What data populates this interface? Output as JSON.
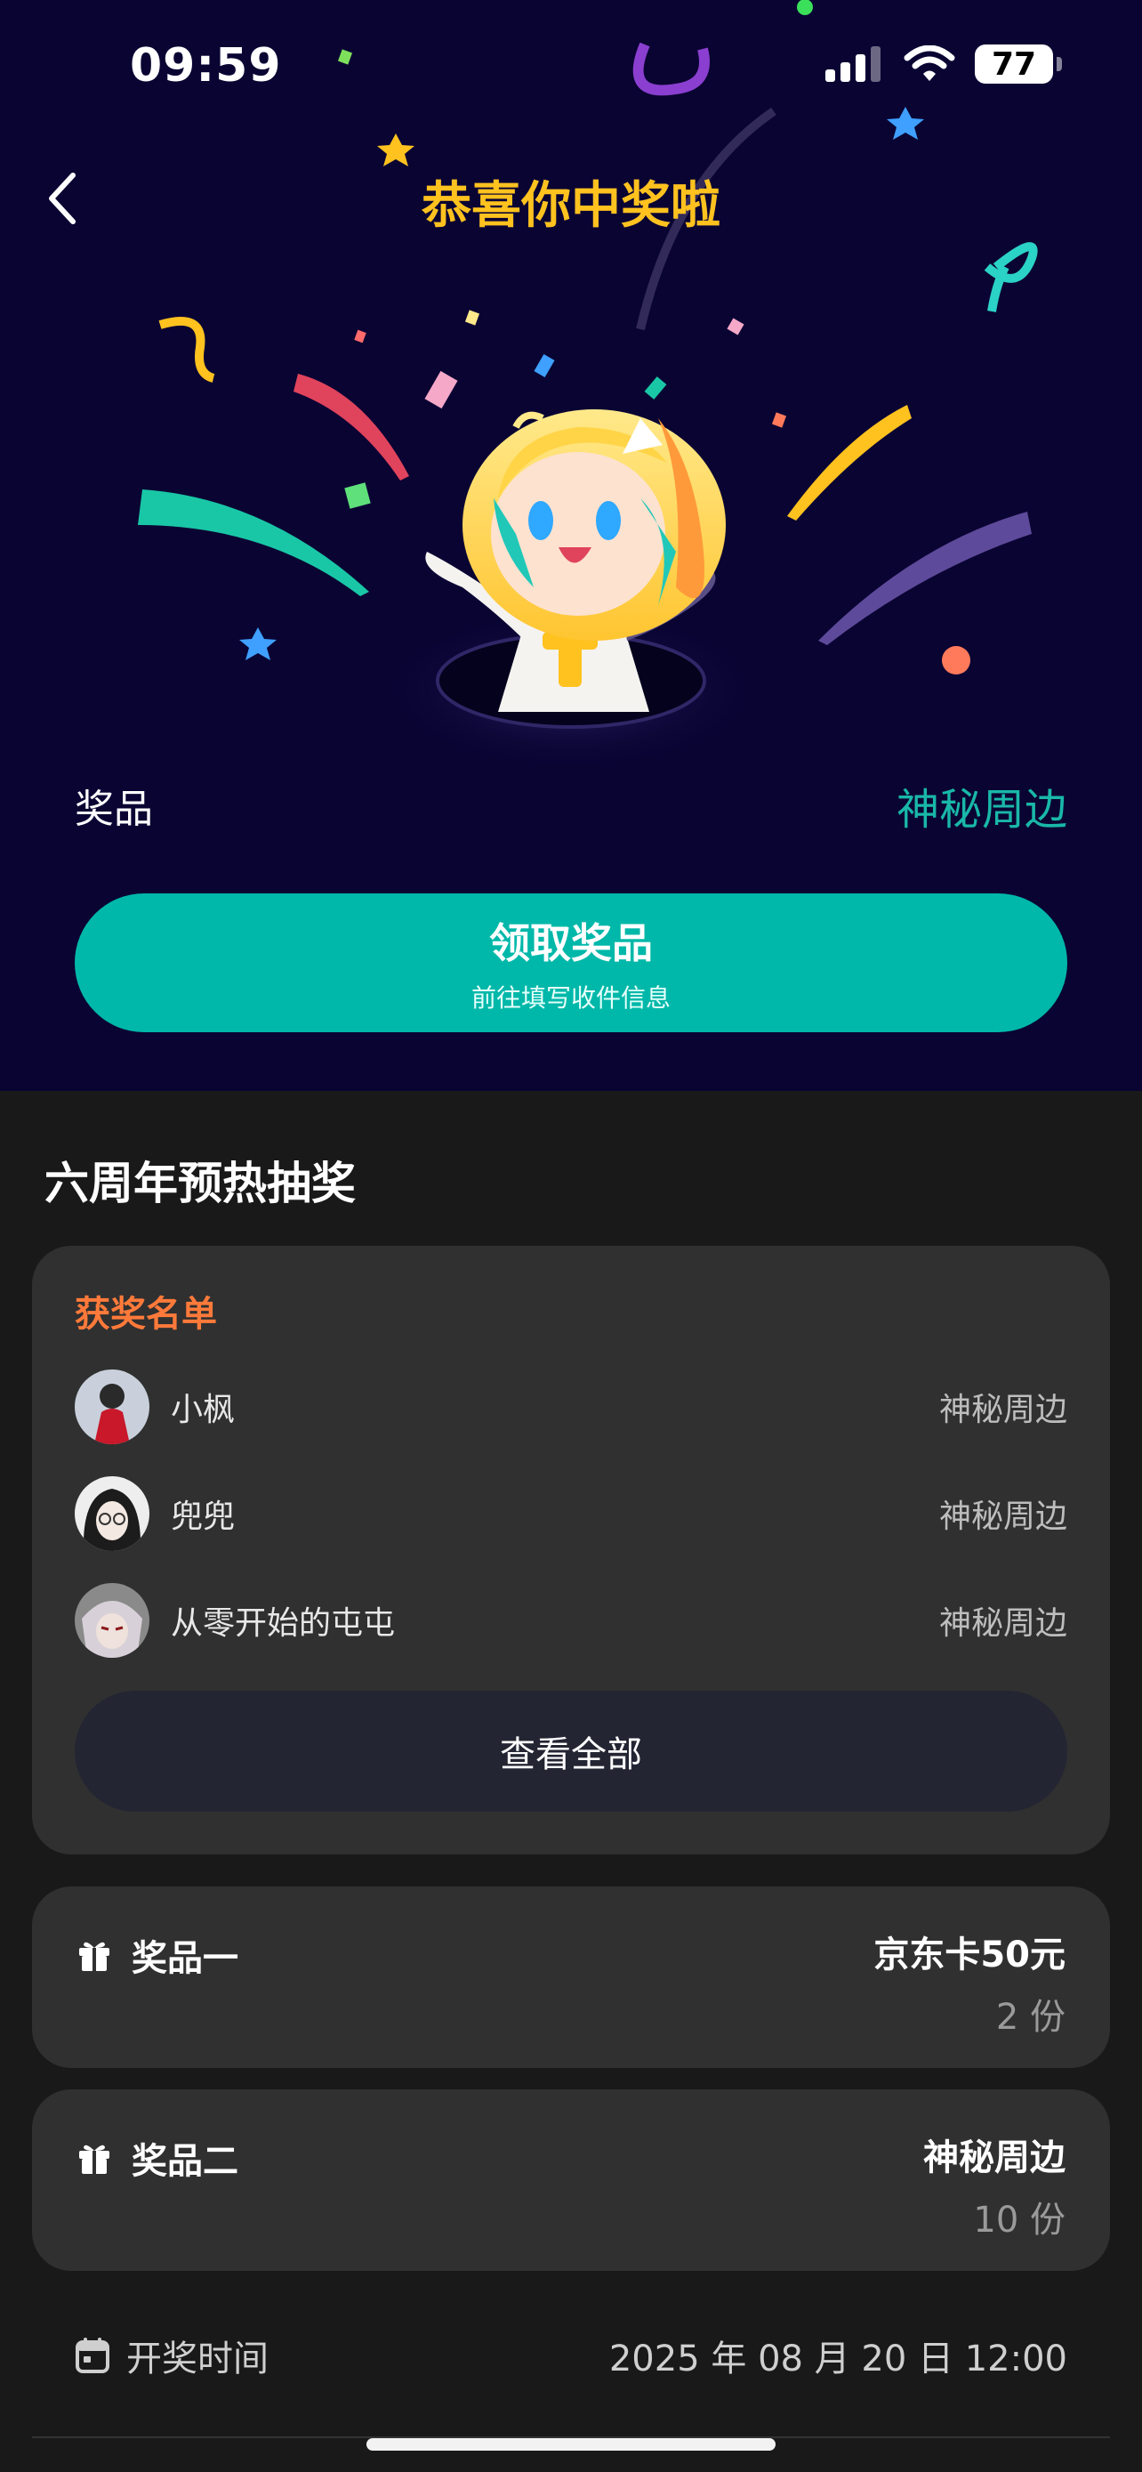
{
  "status_bar": {
    "time": "09:59",
    "battery": "77"
  },
  "header": {
    "title": "恭喜你中奖啦"
  },
  "prize": {
    "label": "奖品",
    "value": "神秘周边"
  },
  "claim_button": {
    "label": "领取奖品",
    "sublabel": "前往填写收件信息"
  },
  "section": {
    "title": "六周年预热抽奖"
  },
  "winners": {
    "title": "获奖名单",
    "items": [
      {
        "name": "小枫",
        "prize": "神秘周边"
      },
      {
        "name": "兜兜",
        "prize": "神秘周边"
      },
      {
        "name": "从零开始的屯屯",
        "prize": "神秘周边"
      }
    ],
    "view_all_label": "查看全部"
  },
  "prizes": [
    {
      "name": "奖品一",
      "value": "京东卡50元",
      "count": "2 份"
    },
    {
      "name": "奖品二",
      "value": "神秘周边",
      "count": "10 份"
    }
  ],
  "draw_time": {
    "label": "开奖时间",
    "value": "2025 年 08 月 20 日 12:00"
  },
  "colors": {
    "hero_bg": "#0a0433",
    "accent": "#00b8a9",
    "title_yellow": "#ffc21f",
    "winners_title": "#ff7a3a"
  }
}
